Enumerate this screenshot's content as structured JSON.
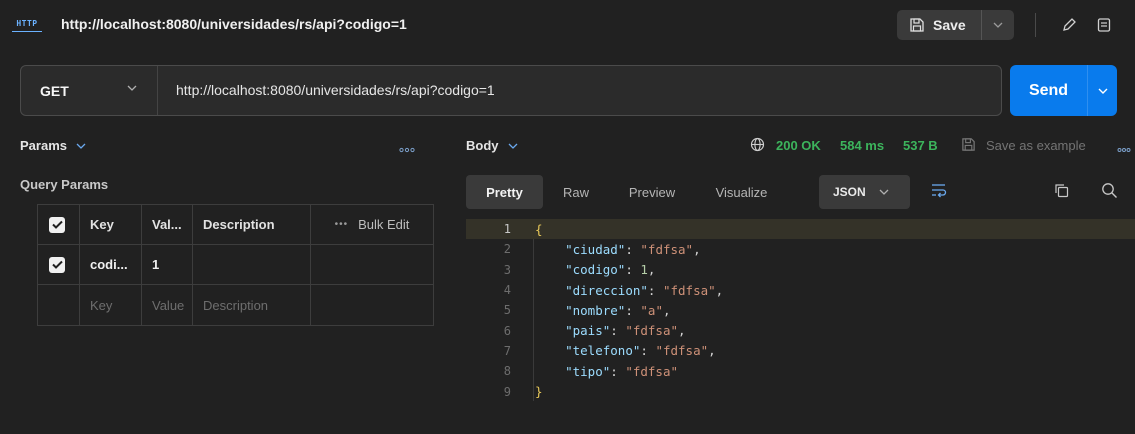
{
  "title_bar": {
    "protocol_badge": "HTTP",
    "title": "http://localhost:8080/universidades/rs/api?codigo=1",
    "save_label": "Save"
  },
  "request": {
    "method": "GET",
    "url": "http://localhost:8080/universidades/rs/api?codigo=1",
    "send_label": "Send"
  },
  "params_pane": {
    "tab_label": "Params",
    "section_title": "Query Params",
    "headers": {
      "key": "Key",
      "value": "Val...",
      "description": "Description",
      "bulk_edit": "Bulk Edit"
    },
    "rows": [
      {
        "checked": true,
        "key": "codi...",
        "value": "1",
        "description": ""
      }
    ],
    "placeholder_row": {
      "key": "Key",
      "value": "Value",
      "description": "Description"
    }
  },
  "response": {
    "tab_label": "Body",
    "status": "200 OK",
    "time": "584 ms",
    "size": "537 B",
    "save_example": "Save as example",
    "view_tabs": [
      "Pretty",
      "Raw",
      "Preview",
      "Visualize"
    ],
    "active_view": "Pretty",
    "format": "JSON",
    "line_numbers": [
      "1",
      "2",
      "3",
      "4",
      "5",
      "6",
      "7",
      "8",
      "9"
    ],
    "lines": {
      "open": "{",
      "close": "}",
      "entries": [
        {
          "key": "\"ciudad\"",
          "value": "\"fdfsa\"",
          "type": "string",
          "comma": true
        },
        {
          "key": "\"codigo\"",
          "value": "1",
          "type": "number",
          "comma": true
        },
        {
          "key": "\"direccion\"",
          "value": "\"fdfsa\"",
          "type": "string",
          "comma": true
        },
        {
          "key": "\"nombre\"",
          "value": "\"a\"",
          "type": "string",
          "comma": true
        },
        {
          "key": "\"pais\"",
          "value": "\"fdfsa\"",
          "type": "string",
          "comma": true
        },
        {
          "key": "\"telefono\"",
          "value": "\"fdfsa\"",
          "type": "string",
          "comma": true
        },
        {
          "key": "\"tipo\"",
          "value": "\"fdfsa\"",
          "type": "string",
          "comma": false
        }
      ]
    }
  },
  "colors": {
    "accent": "#097bed",
    "status_ok": "#3cb45c",
    "background": "#212121"
  }
}
